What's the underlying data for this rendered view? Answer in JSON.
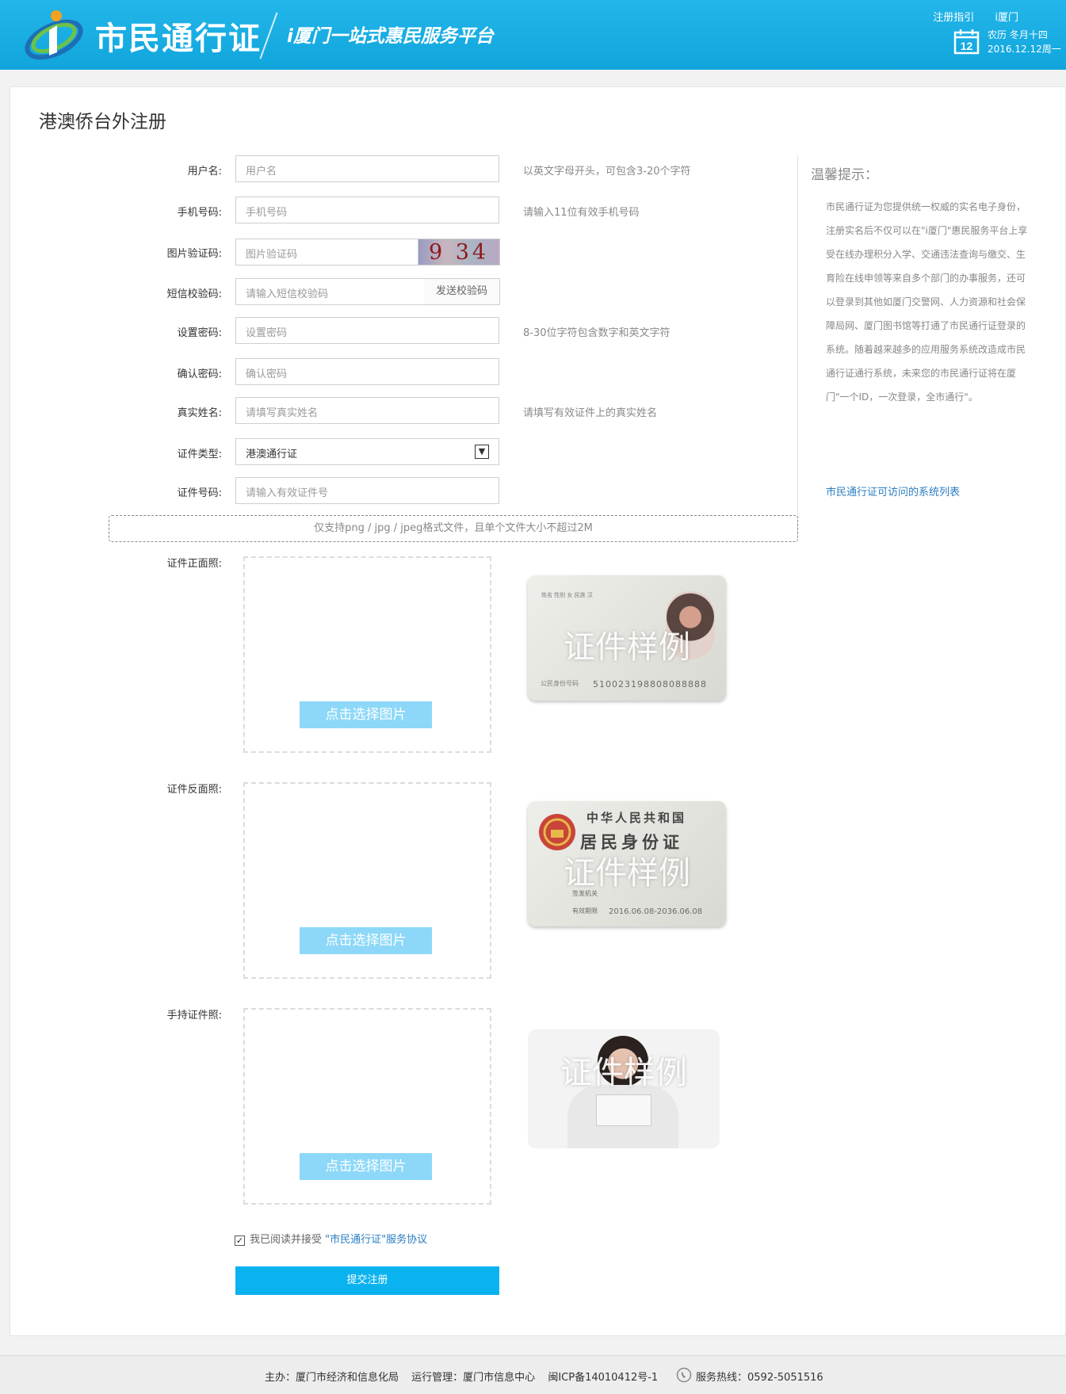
{
  "header": {
    "title": "市民通行证",
    "subtitle": "i厦门一站式惠民服务平台",
    "links": [
      "注册指引",
      "i厦门"
    ],
    "calendar_day": "12",
    "lunar": "农历  冬月十四",
    "date": "2016.12.12周一"
  },
  "page_title": "港澳侨台外注册",
  "form": {
    "username": {
      "label": "用户名:",
      "placeholder": "用户名",
      "hint": "以英文字母开头，可包含3-20个字符"
    },
    "phone": {
      "label": "手机号码:",
      "placeholder": "手机号码",
      "hint": "请输入11位有效手机号码"
    },
    "captcha": {
      "label": "图片验证码:",
      "placeholder": "图片验证码",
      "image_text": "9 34"
    },
    "sms": {
      "label": "短信校验码:",
      "placeholder": "请输入短信校验码",
      "button": "发送校验码"
    },
    "password": {
      "label": "设置密码:",
      "placeholder": "设置密码",
      "hint": "8-30位字符包含数字和英文字符"
    },
    "confirm": {
      "label": "确认密码:",
      "placeholder": "确认密码"
    },
    "realname": {
      "label": "真实姓名:",
      "placeholder": "请填写真实姓名",
      "hint": "请填写有效证件上的真实姓名"
    },
    "idtype": {
      "label": "证件类型:",
      "value": "港澳通行证"
    },
    "idnumber": {
      "label": "证件号码:",
      "placeholder": "请输入有效证件号"
    }
  },
  "format_note": "仅支持png  /  jpg  /  jpeg格式文件，且单个文件大小不超过2M",
  "uploads": [
    {
      "label": "证件正面照:",
      "button": "点击选择图片",
      "sample_mark": "证件样例",
      "sample_number": "510023198808088888",
      "sample_fields": "姓名  性别 女  民族 汉",
      "sample_id_label": "公民身份号码"
    },
    {
      "label": "证件反面照:",
      "button": "点击选择图片",
      "sample_mark": "证件样例",
      "sample_line1": "中华人民共和国",
      "sample_line2": "居民身份证",
      "sample_issuer": "签发机关",
      "sample_valid_label": "有效期限",
      "sample_valid": "2016.06.08-2036.06.08"
    },
    {
      "label": "手持证件照:",
      "button": "点击选择图片",
      "sample_mark": "证件样例"
    }
  ],
  "tips": {
    "title": "温馨提示：",
    "body": "市民通行证为您提供统一权威的实名电子身份，注册实名后不仅可以在\"i厦门\"惠民服务平台上享受在线办理积分入学、交通违法查询与缴交、生育险在线申领等来自多个部门的办事服务，还可以登录到其他如厦门交警网、人力资源和社会保障局网、厦门图书馆等打通了市民通行证登录的系统。随着越来越多的应用服务系统改造成市民通行证通行系统，未来您的市民通行证将在厦门\"一个ID，一次登录，全市通行\"。",
    "link": "市民通行证可访问的系统列表"
  },
  "agreement": {
    "checked": true,
    "text": "我已阅读并接受",
    "link": "\"市民通行证\"服务协议"
  },
  "submit": "提交注册",
  "footer": {
    "sponsor": "主办：厦门市经济和信息化局",
    "operator": "运行管理：厦门市信息中心",
    "icp": "闽ICP备14010412号-1",
    "hotline": "服务热线：0592-5051516"
  },
  "colors": {
    "header": "#18ace3",
    "primary": "#0ab3f0",
    "upload_button": "#8dd8f8",
    "link": "#2a7ec1"
  }
}
